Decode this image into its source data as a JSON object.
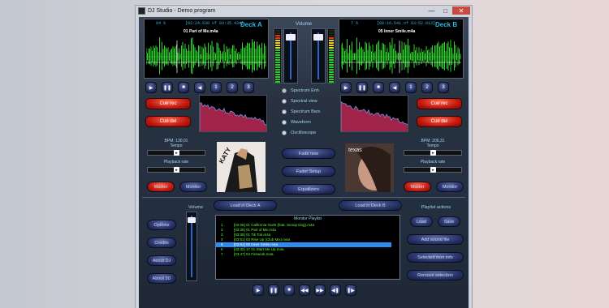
{
  "window": {
    "title": "DJ Studio - Demo program",
    "minimize": "—",
    "maximize": "□",
    "close": "✕"
  },
  "deck_a": {
    "label": "Deck A",
    "time_left": "94 %",
    "time": "[03:24.630 of 03:35.434]",
    "track": "01 Part of Me.m4a",
    "bpm": "BPM: 130,01",
    "tempo_label": "Tempo",
    "playback_label": "Playback rate",
    "cue_rec": "Cue rec",
    "cue_del": "Cue del",
    "master": "Master",
    "monitor": "Monitor",
    "hotcues": [
      "1",
      "2",
      "3"
    ]
  },
  "deck_b": {
    "label": "Deck B",
    "time_left": "7 %",
    "time": "[00:16.541 of 03:52.013]",
    "track": "05 Inner Smile.m4a",
    "bpm": "BPM: 206,31",
    "tempo_label": "Tempo",
    "playback_label": "Playback rate",
    "cue_rec": "Cue rec",
    "cue_del": "Cue del",
    "master": "Master",
    "monitor": "Monitor",
    "hotcues": [
      "1",
      "2",
      "3"
    ],
    "album_title": "texas"
  },
  "volume_label": "Volume",
  "visual_options": [
    "Spectrum Enh",
    "Spectral view",
    "Spectrum Bars",
    "Waveform",
    "Oscilloscope"
  ],
  "visual_selected_index": 0,
  "center_buttons": {
    "fade_now": "Fade now",
    "fader_setup": "Fader Setup",
    "equalizers": "Equalizers"
  },
  "load_a": "Load in Deck A",
  "load_b": "Load in Deck B",
  "left_buttons": {
    "options": "Options",
    "credits": "Credits",
    "about_dj": "About DJ",
    "about_3d": "About 3D"
  },
  "bottom_volume_label": "Volume",
  "playlist": {
    "title": "Monitor Playlist",
    "selected_index": 4,
    "items": [
      {
        "n": "1",
        "text": "[03:26] 01 California Gurls (feat. Snoop Dog).m4a"
      },
      {
        "n": "2",
        "text": "[03:35] 01 Part of Me.m4a"
      },
      {
        "n": "3",
        "text": "[03:35] 01 Tik Tok.m4a"
      },
      {
        "n": "4",
        "text": "[03:51] 03 Rise Up (Club Mix).m4a"
      },
      {
        "n": "5",
        "text": "[03:52] 05 Inner Smile.m4a"
      },
      {
        "n": "6",
        "text": "[03:32] 17 01 Start Me Up.m4a"
      },
      {
        "n": "7",
        "text": "[03:47] 04 Firework.m4a"
      }
    ]
  },
  "playlist_actions": {
    "title": "Playlist actions",
    "load": "Load",
    "save": "Save",
    "add": "Add sound file",
    "info": "Selected item info",
    "remove": "Remove selection"
  },
  "transport": [
    "▶",
    "❚❚",
    "■",
    "◀◀",
    "▶▶",
    "◀❚",
    "❚▶"
  ],
  "deck_controls": [
    "▶",
    "❚❚",
    "■",
    "◀"
  ],
  "colors": {
    "accent": "#29b6e0",
    "cue": "#e0281a",
    "playlist_text": "#5cff3b",
    "selection": "#2f8bf0"
  }
}
